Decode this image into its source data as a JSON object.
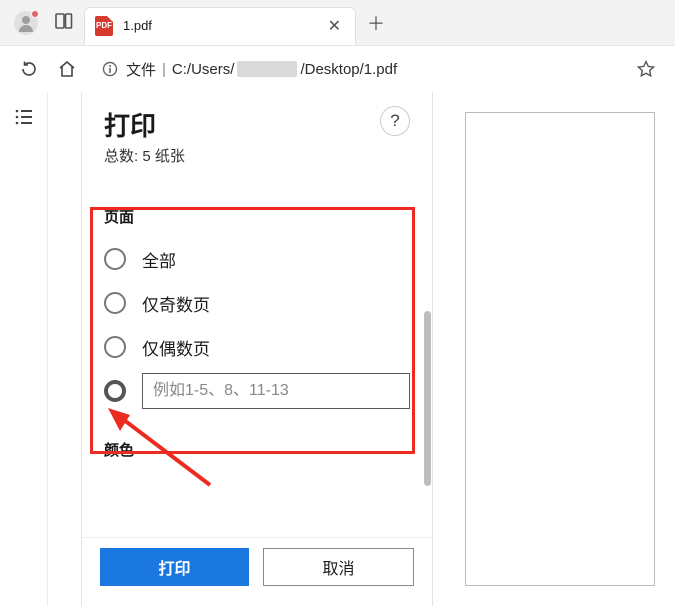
{
  "titlebar": {
    "tab_title": "1.pdf"
  },
  "addrbar": {
    "proto_label": "文件",
    "path_prefix": "C:/Users/",
    "path_suffix": "/Desktop/1.pdf"
  },
  "print_panel": {
    "title": "打印",
    "summary": "总数: 5 纸张",
    "help_label": "?",
    "pages": {
      "section_label": "页面",
      "options": {
        "all": "全部",
        "odd": "仅奇数页",
        "even": "仅偶数页"
      },
      "custom_placeholder": "例如1-5、8、11-13"
    },
    "color": {
      "section_label": "颜色"
    },
    "buttons": {
      "print": "打印",
      "cancel": "取消"
    }
  }
}
